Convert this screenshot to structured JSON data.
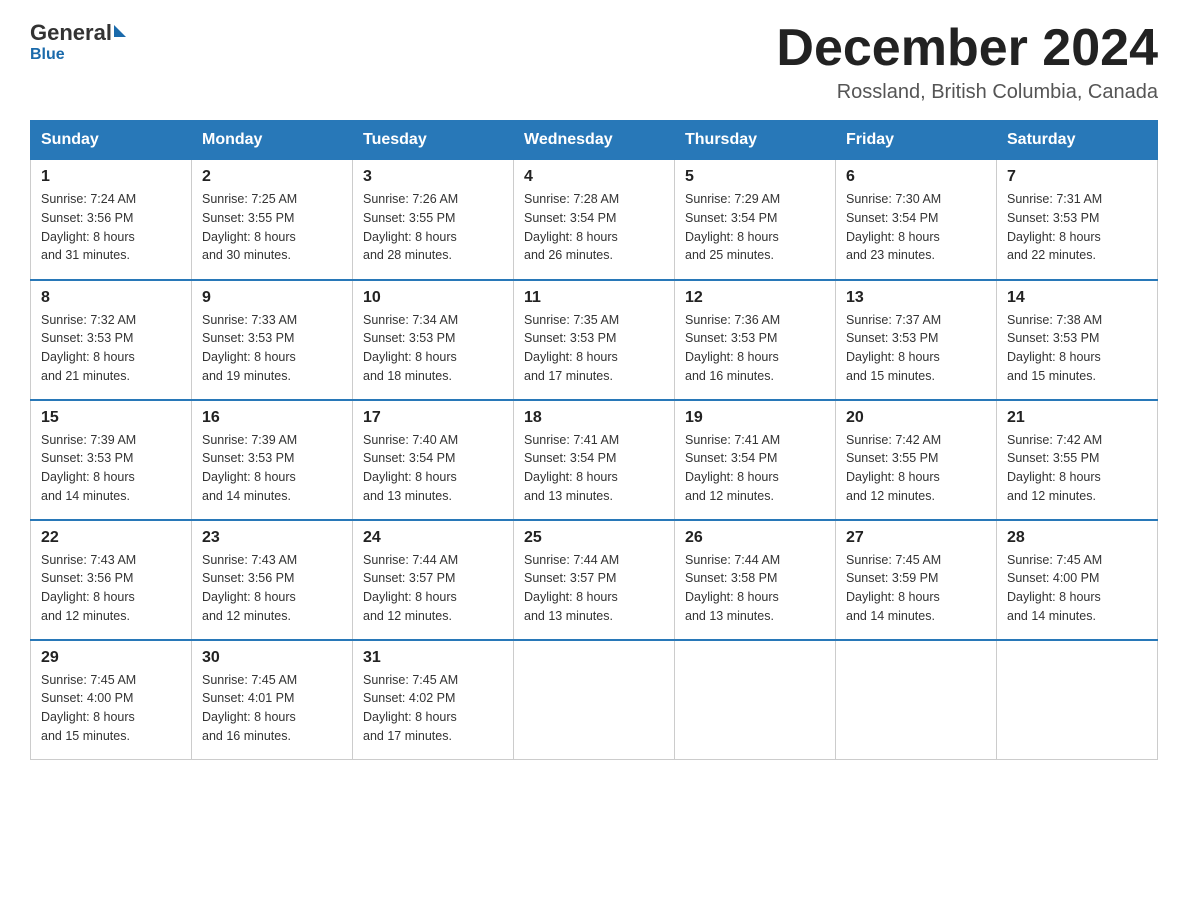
{
  "header": {
    "logo_general": "General",
    "logo_blue": "Blue",
    "month_title": "December 2024",
    "location": "Rossland, British Columbia, Canada"
  },
  "days_of_week": [
    "Sunday",
    "Monday",
    "Tuesday",
    "Wednesday",
    "Thursday",
    "Friday",
    "Saturday"
  ],
  "weeks": [
    [
      {
        "day": "1",
        "sunrise": "7:24 AM",
        "sunset": "3:56 PM",
        "daylight": "8 hours and 31 minutes."
      },
      {
        "day": "2",
        "sunrise": "7:25 AM",
        "sunset": "3:55 PM",
        "daylight": "8 hours and 30 minutes."
      },
      {
        "day": "3",
        "sunrise": "7:26 AM",
        "sunset": "3:55 PM",
        "daylight": "8 hours and 28 minutes."
      },
      {
        "day": "4",
        "sunrise": "7:28 AM",
        "sunset": "3:54 PM",
        "daylight": "8 hours and 26 minutes."
      },
      {
        "day": "5",
        "sunrise": "7:29 AM",
        "sunset": "3:54 PM",
        "daylight": "8 hours and 25 minutes."
      },
      {
        "day": "6",
        "sunrise": "7:30 AM",
        "sunset": "3:54 PM",
        "daylight": "8 hours and 23 minutes."
      },
      {
        "day": "7",
        "sunrise": "7:31 AM",
        "sunset": "3:53 PM",
        "daylight": "8 hours and 22 minutes."
      }
    ],
    [
      {
        "day": "8",
        "sunrise": "7:32 AM",
        "sunset": "3:53 PM",
        "daylight": "8 hours and 21 minutes."
      },
      {
        "day": "9",
        "sunrise": "7:33 AM",
        "sunset": "3:53 PM",
        "daylight": "8 hours and 19 minutes."
      },
      {
        "day": "10",
        "sunrise": "7:34 AM",
        "sunset": "3:53 PM",
        "daylight": "8 hours and 18 minutes."
      },
      {
        "day": "11",
        "sunrise": "7:35 AM",
        "sunset": "3:53 PM",
        "daylight": "8 hours and 17 minutes."
      },
      {
        "day": "12",
        "sunrise": "7:36 AM",
        "sunset": "3:53 PM",
        "daylight": "8 hours and 16 minutes."
      },
      {
        "day": "13",
        "sunrise": "7:37 AM",
        "sunset": "3:53 PM",
        "daylight": "8 hours and 15 minutes."
      },
      {
        "day": "14",
        "sunrise": "7:38 AM",
        "sunset": "3:53 PM",
        "daylight": "8 hours and 15 minutes."
      }
    ],
    [
      {
        "day": "15",
        "sunrise": "7:39 AM",
        "sunset": "3:53 PM",
        "daylight": "8 hours and 14 minutes."
      },
      {
        "day": "16",
        "sunrise": "7:39 AM",
        "sunset": "3:53 PM",
        "daylight": "8 hours and 14 minutes."
      },
      {
        "day": "17",
        "sunrise": "7:40 AM",
        "sunset": "3:54 PM",
        "daylight": "8 hours and 13 minutes."
      },
      {
        "day": "18",
        "sunrise": "7:41 AM",
        "sunset": "3:54 PM",
        "daylight": "8 hours and 13 minutes."
      },
      {
        "day": "19",
        "sunrise": "7:41 AM",
        "sunset": "3:54 PM",
        "daylight": "8 hours and 12 minutes."
      },
      {
        "day": "20",
        "sunrise": "7:42 AM",
        "sunset": "3:55 PM",
        "daylight": "8 hours and 12 minutes."
      },
      {
        "day": "21",
        "sunrise": "7:42 AM",
        "sunset": "3:55 PM",
        "daylight": "8 hours and 12 minutes."
      }
    ],
    [
      {
        "day": "22",
        "sunrise": "7:43 AM",
        "sunset": "3:56 PM",
        "daylight": "8 hours and 12 minutes."
      },
      {
        "day": "23",
        "sunrise": "7:43 AM",
        "sunset": "3:56 PM",
        "daylight": "8 hours and 12 minutes."
      },
      {
        "day": "24",
        "sunrise": "7:44 AM",
        "sunset": "3:57 PM",
        "daylight": "8 hours and 12 minutes."
      },
      {
        "day": "25",
        "sunrise": "7:44 AM",
        "sunset": "3:57 PM",
        "daylight": "8 hours and 13 minutes."
      },
      {
        "day": "26",
        "sunrise": "7:44 AM",
        "sunset": "3:58 PM",
        "daylight": "8 hours and 13 minutes."
      },
      {
        "day": "27",
        "sunrise": "7:45 AM",
        "sunset": "3:59 PM",
        "daylight": "8 hours and 14 minutes."
      },
      {
        "day": "28",
        "sunrise": "7:45 AM",
        "sunset": "4:00 PM",
        "daylight": "8 hours and 14 minutes."
      }
    ],
    [
      {
        "day": "29",
        "sunrise": "7:45 AM",
        "sunset": "4:00 PM",
        "daylight": "8 hours and 15 minutes."
      },
      {
        "day": "30",
        "sunrise": "7:45 AM",
        "sunset": "4:01 PM",
        "daylight": "8 hours and 16 minutes."
      },
      {
        "day": "31",
        "sunrise": "7:45 AM",
        "sunset": "4:02 PM",
        "daylight": "8 hours and 17 minutes."
      },
      null,
      null,
      null,
      null
    ]
  ]
}
